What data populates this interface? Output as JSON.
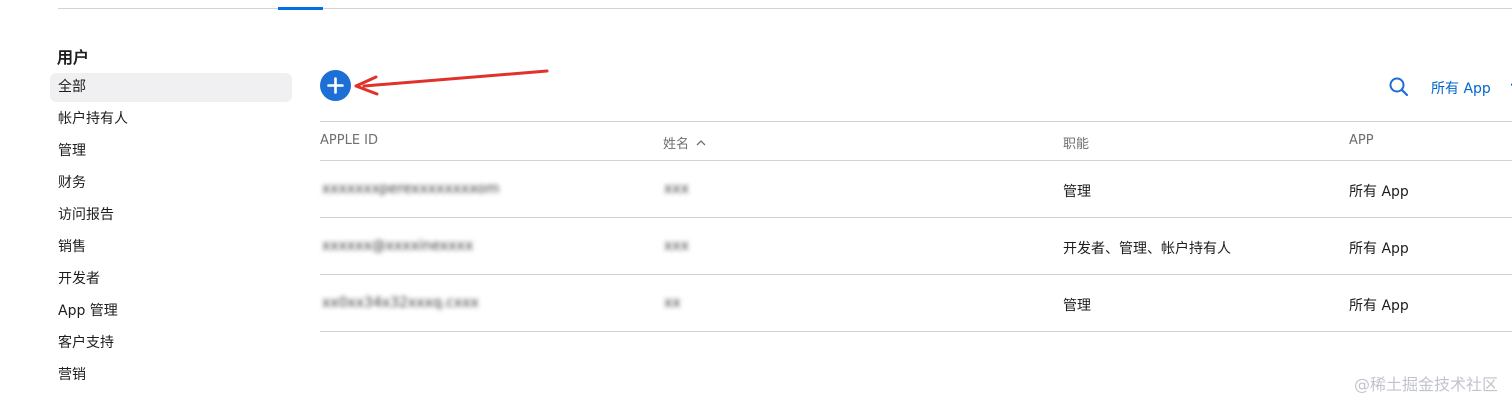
{
  "sidebar": {
    "title": "用户",
    "items": [
      {
        "label": "全部",
        "active": true
      },
      {
        "label": "帐户持有人"
      },
      {
        "label": "管理"
      },
      {
        "label": "财务"
      },
      {
        "label": "访问报告"
      },
      {
        "label": "销售"
      },
      {
        "label": "开发者"
      },
      {
        "label": "App 管理"
      },
      {
        "label": "客户支持"
      },
      {
        "label": "营销"
      }
    ]
  },
  "toolbar": {
    "add_icon": "plus-icon",
    "search_icon": "magnifier-icon",
    "filter_label": "所有 App",
    "filter_icon": "chevron-down-icon"
  },
  "table": {
    "columns": [
      "APPLE ID",
      "姓名",
      "职能",
      "APP"
    ],
    "sort_indicator": "^",
    "rows": [
      {
        "apple_id": "xxxxxxxperexxxxxxxxom",
        "name": "xxx",
        "role": "管理",
        "app": "所有 App"
      },
      {
        "apple_id": "xxxxxx@xxxxinexxxx",
        "name": "xxx",
        "role": "开发者、管理、帐户持有人",
        "app": "所有 App"
      },
      {
        "apple_id": "xx0xx34x32xxxq.cxxx",
        "name": "xx",
        "role": "管理",
        "app": "所有 App"
      }
    ]
  },
  "colors": {
    "accent": "#1d6fd6",
    "link": "#0066cc",
    "annotation_arrow": "#e0322b"
  },
  "watermark": "@稀土掘金技术社区"
}
